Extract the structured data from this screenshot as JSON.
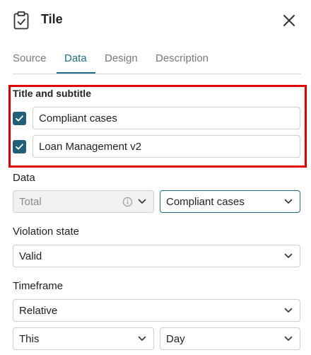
{
  "header": {
    "title": "Tile",
    "icon": "clipboard-check-icon"
  },
  "tabs": [
    {
      "label": "Source",
      "active": false
    },
    {
      "label": "Data",
      "active": true
    },
    {
      "label": "Design",
      "active": false
    },
    {
      "label": "Description",
      "active": false
    }
  ],
  "title_section": {
    "label": "Title and subtitle",
    "title": {
      "checked": true,
      "value": "Compliant cases"
    },
    "subtitle": {
      "checked": true,
      "value": "Loan Management v2"
    }
  },
  "data_section": {
    "label": "Data",
    "aggregation": {
      "value": "Total",
      "disabled": true
    },
    "metric": {
      "value": "Compliant cases"
    }
  },
  "violation_section": {
    "label": "Violation state",
    "value": "Valid"
  },
  "timeframe_section": {
    "label": "Timeframe",
    "mode": "Relative",
    "period": "This",
    "unit": "Day"
  },
  "colors": {
    "accent": "#1f6f8b",
    "checkbox": "#1e5f7a",
    "highlight": "#e00000"
  }
}
